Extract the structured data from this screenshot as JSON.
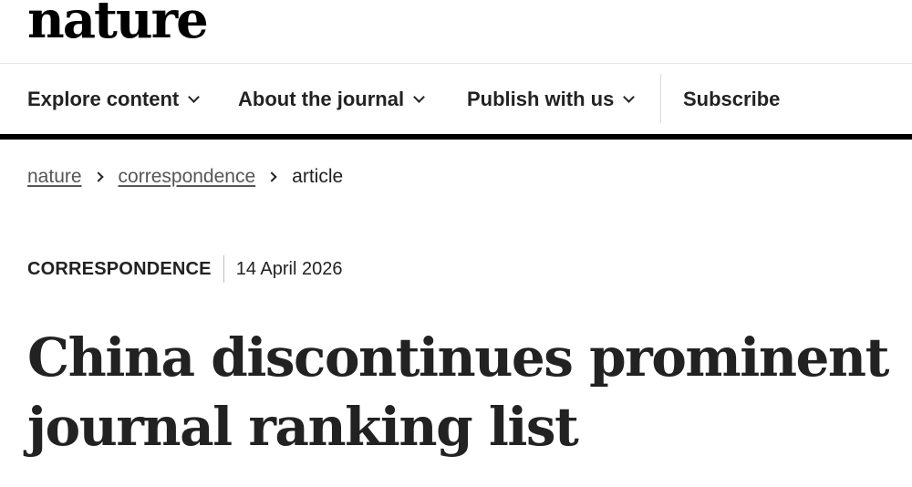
{
  "site": {
    "logo": "nature"
  },
  "nav": {
    "explore": "Explore content",
    "about": "About the journal",
    "publish": "Publish with us",
    "subscribe": "Subscribe"
  },
  "breadcrumb": {
    "items": [
      "nature",
      "correspondence"
    ],
    "current": "article"
  },
  "article": {
    "type": "CORRESPONDENCE",
    "date": "14 April 2026",
    "title": "China discontinues prominent journal ranking list"
  }
}
